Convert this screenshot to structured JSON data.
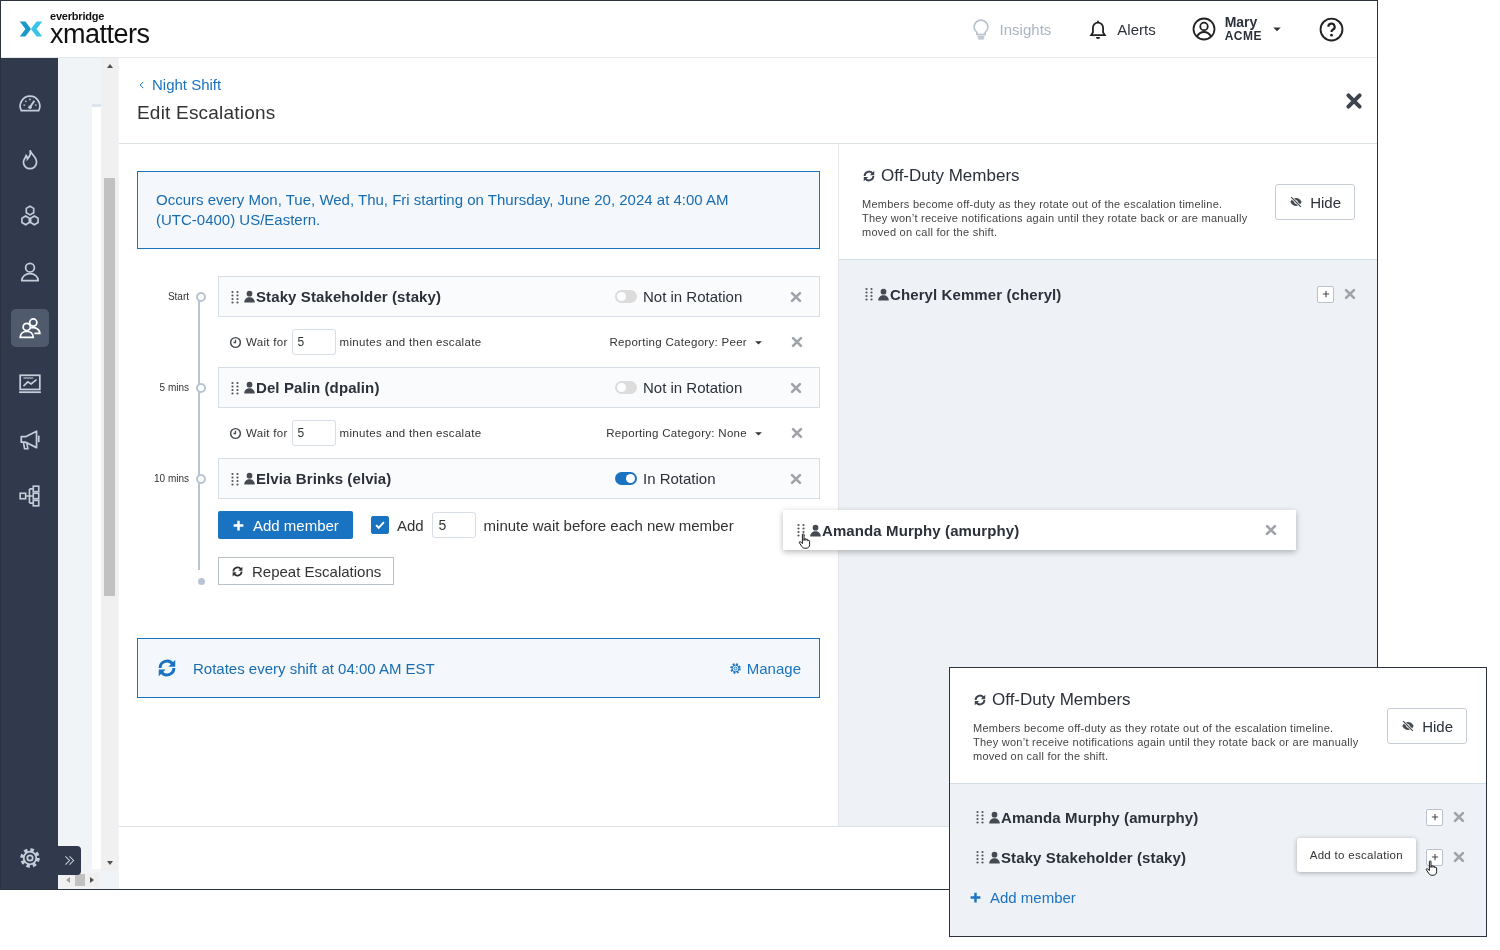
{
  "header": {
    "logo": {
      "brand": "everbridge",
      "product": "xmatters"
    },
    "nav": [
      {
        "kind": "insights",
        "label": "Insights",
        "disabled": true
      },
      {
        "kind": "alerts",
        "label": "Alerts",
        "disabled": false
      }
    ],
    "user": {
      "name": "Mary",
      "org": "ACME"
    }
  },
  "sidebar": {
    "items": [
      {
        "kind": "dashboard",
        "selected": false
      },
      {
        "kind": "incidents",
        "selected": false
      },
      {
        "kind": "workflows",
        "selected": false
      },
      {
        "kind": "user",
        "selected": false
      },
      {
        "kind": "groups",
        "selected": true
      },
      {
        "kind": "reports",
        "selected": false
      },
      {
        "kind": "messaging",
        "selected": false
      },
      {
        "kind": "hierarchy",
        "selected": false
      }
    ]
  },
  "page": {
    "breadcrumb": "Night Shift",
    "title": "Edit Escalations"
  },
  "schedule_notice": "Occurs every Mon, Tue, Wed, Thu, Fri starting on Thursday, June 20, 2024 at 4:00 AM (UTC-0400) US/Eastern.",
  "members": [
    {
      "time_label": "Start",
      "name": "Staky Stakeholder (staky)",
      "in_rotation": false,
      "rotation_label": "Not in Rotation",
      "wait": {
        "before": "Wait for",
        "value": "5",
        "after": "minutes and then escalate",
        "category": "Reporting Category: Peer"
      }
    },
    {
      "time_label": "5 mins",
      "name": "Del Palin (dpalin)",
      "in_rotation": false,
      "rotation_label": "Not in Rotation",
      "wait": {
        "before": "Wait for",
        "value": "5",
        "after": "minutes and then escalate",
        "category": "Reporting Category: None"
      }
    },
    {
      "time_label": "10 mins",
      "name": "Elvia Brinks (elvia)",
      "in_rotation": true,
      "rotation_label": "In Rotation"
    }
  ],
  "add_member_button": "Add member",
  "auto_wait": {
    "checked": true,
    "before": "Add",
    "value": "5",
    "after": "minute wait before each new member"
  },
  "repeat_button": "Repeat Escalations",
  "rotation": {
    "text": "Rotates every shift at 04:00 AM EST",
    "action": "Manage"
  },
  "off_duty": {
    "title": "Off-Duty Members",
    "description": "Members become off-duty as they rotate out of the escalation timeline. They won’t receive notifications again until they rotate back or are manually moved on call for the shift.",
    "hide_button": "Hide",
    "members": [
      {
        "name": "Cheryl Kemmer (cheryl)"
      }
    ]
  },
  "dragged_member": {
    "name": "Amanda Murphy (amurphy)"
  },
  "callout": {
    "title": "Off-Duty Members",
    "description": "Members become off-duty as they rotate out of the escalation timeline. They won’t receive notifications again until they rotate back or are manually moved on call for the shift.",
    "hide_button": "Hide",
    "members": [
      {
        "name": "Amanda Murphy (amurphy)"
      },
      {
        "name": "Staky Stakeholder (staky)",
        "tooltip": "Add to escalation"
      }
    ],
    "add_member": "Add member"
  }
}
